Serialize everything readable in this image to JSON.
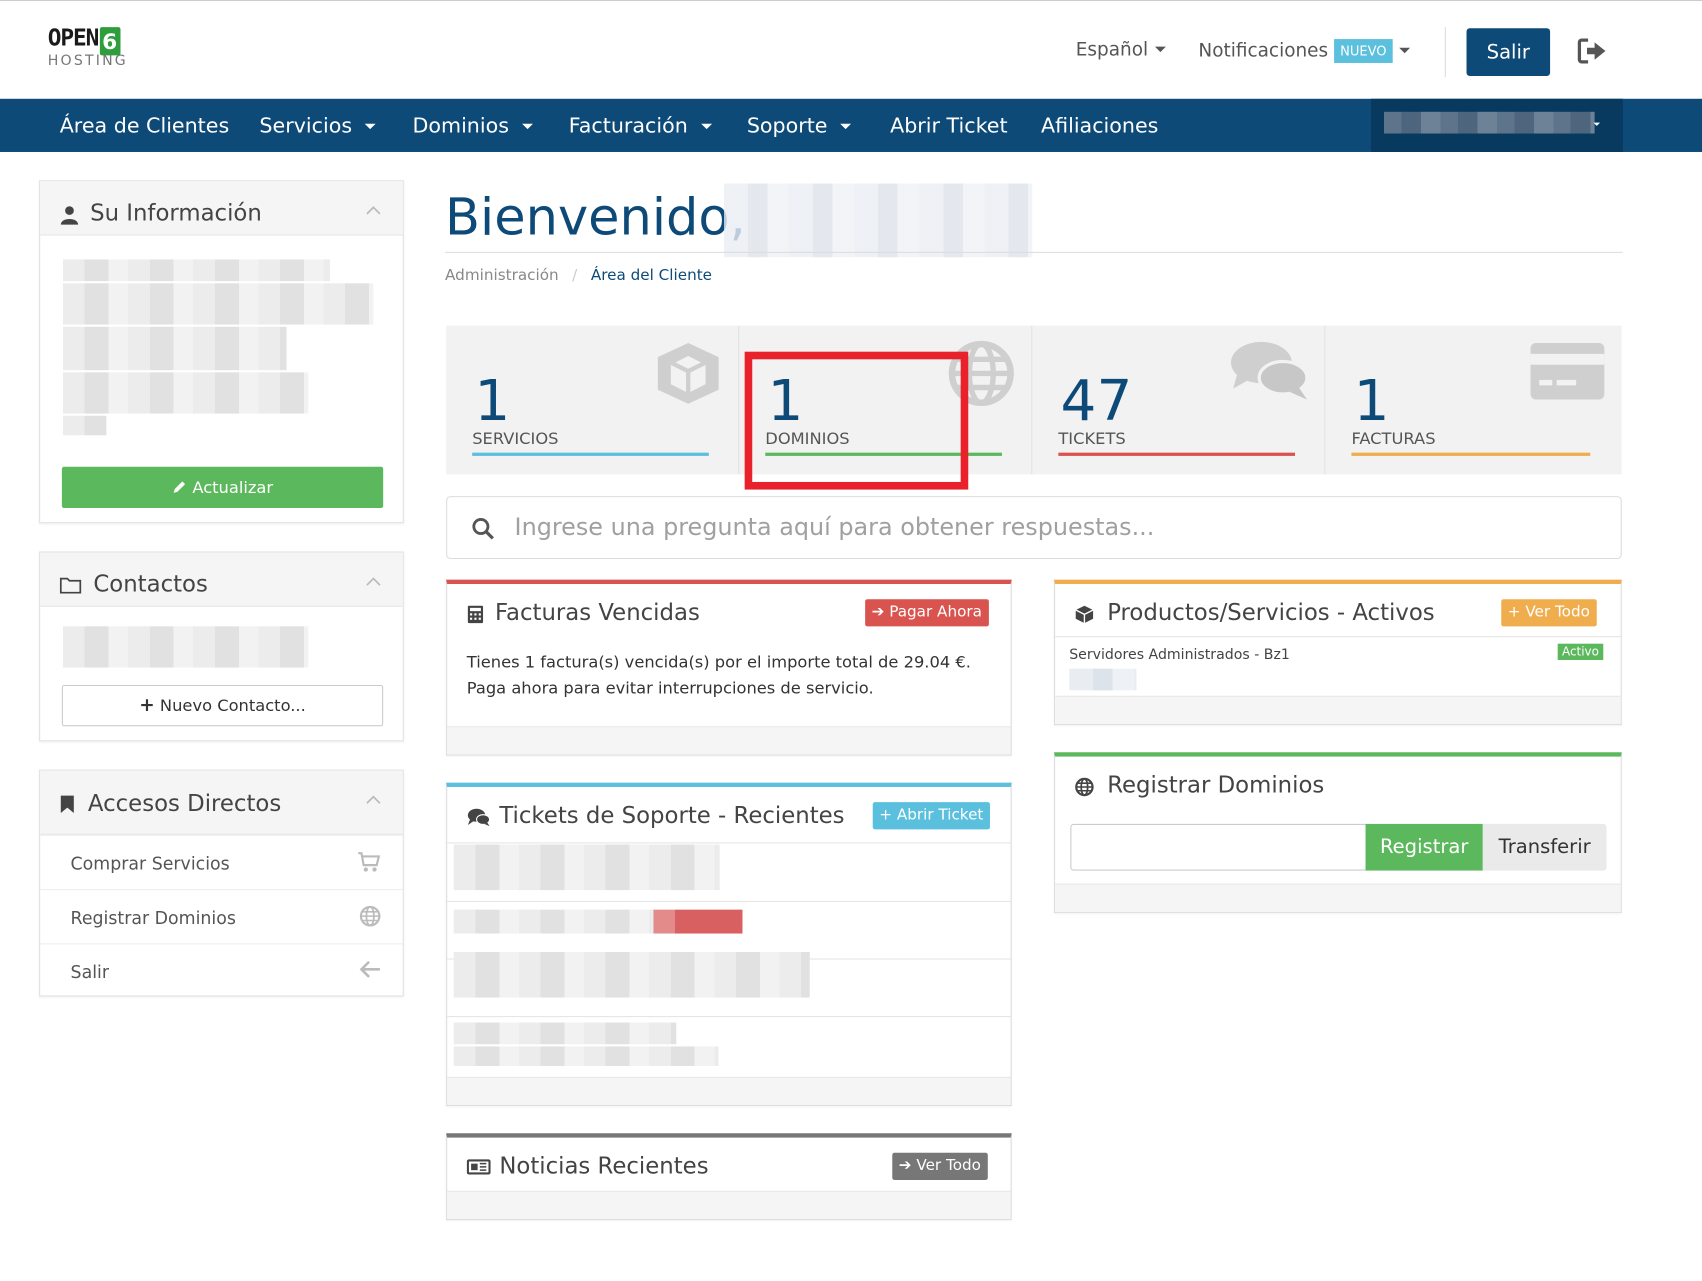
{
  "header": {
    "logo_main": "OPEN",
    "logo_digit": "6",
    "logo_sub": "HOSTING",
    "language": "Español",
    "notifications": "Notificaciones",
    "notifications_badge": "NUEVO",
    "logout_button": "Salir"
  },
  "nav": {
    "items": [
      {
        "label": "Área de Clientes"
      },
      {
        "label": "Servicios"
      },
      {
        "label": "Dominios"
      },
      {
        "label": "Facturación"
      },
      {
        "label": "Soporte"
      },
      {
        "label": "Abrir Ticket"
      },
      {
        "label": "Afiliaciones"
      }
    ]
  },
  "sidebar": {
    "info_title": "Su Información",
    "update_button": "Actualizar",
    "contacts_title": "Contactos",
    "new_contact_button": "Nuevo Contacto...",
    "shortcuts_title": "Accesos Directos",
    "shortcuts": [
      {
        "label": "Comprar Servicios",
        "icon": "cart-icon"
      },
      {
        "label": "Registrar Dominios",
        "icon": "globe-icon"
      },
      {
        "label": "Salir",
        "icon": "arrow-left-icon"
      }
    ]
  },
  "main": {
    "welcome": "Bienvenido,",
    "breadcrumb": {
      "root": "Administración",
      "separator": "/",
      "current": "Área del Cliente"
    },
    "stats": [
      {
        "value": "1",
        "label": "Servicios",
        "color": "#5bc0de",
        "icon": "cube-icon"
      },
      {
        "value": "1",
        "label": "Dominios",
        "color": "#5cb85c",
        "icon": "globe-icon"
      },
      {
        "value": "47",
        "label": "Tickets",
        "color": "#d9534f",
        "icon": "comments-icon"
      },
      {
        "value": "1",
        "label": "Facturas",
        "color": "#f0ad4e",
        "icon": "credit-card-icon"
      }
    ],
    "search_placeholder": "Ingrese una pregunta aquí para obtener respuestas...",
    "overdue": {
      "title": "Facturas Vencidas",
      "button": "Pagar Ahora",
      "line1": "Tienes 1 factura(s) vencida(s) por el importe total de 29.04 €.",
      "line2": "Paga ahora para evitar interrupciones de servicio."
    },
    "tickets": {
      "title": "Tickets de Soporte - Recientes",
      "button": "Abrir Ticket"
    },
    "news": {
      "title": "Noticias Recientes",
      "button": "Ver Todo"
    },
    "products": {
      "title": "Productos/Servicios - Activos",
      "button": "Ver Todo",
      "item_name": "Servidores Administrados - Bz1",
      "item_status": "Activo"
    },
    "register_domains": {
      "title": "Registrar Dominios",
      "register_button": "Registrar",
      "transfer_button": "Transferir"
    }
  },
  "colors": {
    "brand": "#0e4a78",
    "green": "#5cb85c",
    "info": "#5bc0de",
    "danger": "#d9534f",
    "warning": "#f0ad4e",
    "highlight": "#e8212a"
  }
}
